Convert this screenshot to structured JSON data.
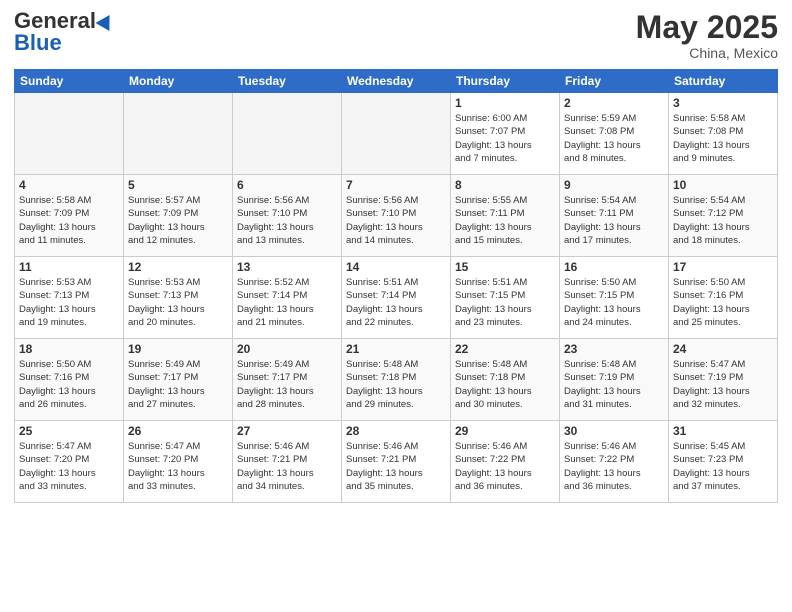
{
  "header": {
    "logo_general": "General",
    "logo_blue": "Blue",
    "title": "May 2025",
    "subtitle": "China, Mexico"
  },
  "days_of_week": [
    "Sunday",
    "Monday",
    "Tuesday",
    "Wednesday",
    "Thursday",
    "Friday",
    "Saturday"
  ],
  "weeks": [
    [
      {
        "day": "",
        "empty": true
      },
      {
        "day": "",
        "empty": true
      },
      {
        "day": "",
        "empty": true
      },
      {
        "day": "",
        "empty": true
      },
      {
        "day": "1",
        "lines": [
          "Sunrise: 6:00 AM",
          "Sunset: 7:07 PM",
          "Daylight: 13 hours",
          "and 7 minutes."
        ]
      },
      {
        "day": "2",
        "lines": [
          "Sunrise: 5:59 AM",
          "Sunset: 7:08 PM",
          "Daylight: 13 hours",
          "and 8 minutes."
        ]
      },
      {
        "day": "3",
        "lines": [
          "Sunrise: 5:58 AM",
          "Sunset: 7:08 PM",
          "Daylight: 13 hours",
          "and 9 minutes."
        ]
      }
    ],
    [
      {
        "day": "4",
        "lines": [
          "Sunrise: 5:58 AM",
          "Sunset: 7:09 PM",
          "Daylight: 13 hours",
          "and 11 minutes."
        ]
      },
      {
        "day": "5",
        "lines": [
          "Sunrise: 5:57 AM",
          "Sunset: 7:09 PM",
          "Daylight: 13 hours",
          "and 12 minutes."
        ]
      },
      {
        "day": "6",
        "lines": [
          "Sunrise: 5:56 AM",
          "Sunset: 7:10 PM",
          "Daylight: 13 hours",
          "and 13 minutes."
        ]
      },
      {
        "day": "7",
        "lines": [
          "Sunrise: 5:56 AM",
          "Sunset: 7:10 PM",
          "Daylight: 13 hours",
          "and 14 minutes."
        ]
      },
      {
        "day": "8",
        "lines": [
          "Sunrise: 5:55 AM",
          "Sunset: 7:11 PM",
          "Daylight: 13 hours",
          "and 15 minutes."
        ]
      },
      {
        "day": "9",
        "lines": [
          "Sunrise: 5:54 AM",
          "Sunset: 7:11 PM",
          "Daylight: 13 hours",
          "and 17 minutes."
        ]
      },
      {
        "day": "10",
        "lines": [
          "Sunrise: 5:54 AM",
          "Sunset: 7:12 PM",
          "Daylight: 13 hours",
          "and 18 minutes."
        ]
      }
    ],
    [
      {
        "day": "11",
        "lines": [
          "Sunrise: 5:53 AM",
          "Sunset: 7:13 PM",
          "Daylight: 13 hours",
          "and 19 minutes."
        ]
      },
      {
        "day": "12",
        "lines": [
          "Sunrise: 5:53 AM",
          "Sunset: 7:13 PM",
          "Daylight: 13 hours",
          "and 20 minutes."
        ]
      },
      {
        "day": "13",
        "lines": [
          "Sunrise: 5:52 AM",
          "Sunset: 7:14 PM",
          "Daylight: 13 hours",
          "and 21 minutes."
        ]
      },
      {
        "day": "14",
        "lines": [
          "Sunrise: 5:51 AM",
          "Sunset: 7:14 PM",
          "Daylight: 13 hours",
          "and 22 minutes."
        ]
      },
      {
        "day": "15",
        "lines": [
          "Sunrise: 5:51 AM",
          "Sunset: 7:15 PM",
          "Daylight: 13 hours",
          "and 23 minutes."
        ]
      },
      {
        "day": "16",
        "lines": [
          "Sunrise: 5:50 AM",
          "Sunset: 7:15 PM",
          "Daylight: 13 hours",
          "and 24 minutes."
        ]
      },
      {
        "day": "17",
        "lines": [
          "Sunrise: 5:50 AM",
          "Sunset: 7:16 PM",
          "Daylight: 13 hours",
          "and 25 minutes."
        ]
      }
    ],
    [
      {
        "day": "18",
        "lines": [
          "Sunrise: 5:50 AM",
          "Sunset: 7:16 PM",
          "Daylight: 13 hours",
          "and 26 minutes."
        ]
      },
      {
        "day": "19",
        "lines": [
          "Sunrise: 5:49 AM",
          "Sunset: 7:17 PM",
          "Daylight: 13 hours",
          "and 27 minutes."
        ]
      },
      {
        "day": "20",
        "lines": [
          "Sunrise: 5:49 AM",
          "Sunset: 7:17 PM",
          "Daylight: 13 hours",
          "and 28 minutes."
        ]
      },
      {
        "day": "21",
        "lines": [
          "Sunrise: 5:48 AM",
          "Sunset: 7:18 PM",
          "Daylight: 13 hours",
          "and 29 minutes."
        ]
      },
      {
        "day": "22",
        "lines": [
          "Sunrise: 5:48 AM",
          "Sunset: 7:18 PM",
          "Daylight: 13 hours",
          "and 30 minutes."
        ]
      },
      {
        "day": "23",
        "lines": [
          "Sunrise: 5:48 AM",
          "Sunset: 7:19 PM",
          "Daylight: 13 hours",
          "and 31 minutes."
        ]
      },
      {
        "day": "24",
        "lines": [
          "Sunrise: 5:47 AM",
          "Sunset: 7:19 PM",
          "Daylight: 13 hours",
          "and 32 minutes."
        ]
      }
    ],
    [
      {
        "day": "25",
        "lines": [
          "Sunrise: 5:47 AM",
          "Sunset: 7:20 PM",
          "Daylight: 13 hours",
          "and 33 minutes."
        ]
      },
      {
        "day": "26",
        "lines": [
          "Sunrise: 5:47 AM",
          "Sunset: 7:20 PM",
          "Daylight: 13 hours",
          "and 33 minutes."
        ]
      },
      {
        "day": "27",
        "lines": [
          "Sunrise: 5:46 AM",
          "Sunset: 7:21 PM",
          "Daylight: 13 hours",
          "and 34 minutes."
        ]
      },
      {
        "day": "28",
        "lines": [
          "Sunrise: 5:46 AM",
          "Sunset: 7:21 PM",
          "Daylight: 13 hours",
          "and 35 minutes."
        ]
      },
      {
        "day": "29",
        "lines": [
          "Sunrise: 5:46 AM",
          "Sunset: 7:22 PM",
          "Daylight: 13 hours",
          "and 36 minutes."
        ]
      },
      {
        "day": "30",
        "lines": [
          "Sunrise: 5:46 AM",
          "Sunset: 7:22 PM",
          "Daylight: 13 hours",
          "and 36 minutes."
        ]
      },
      {
        "day": "31",
        "lines": [
          "Sunrise: 5:45 AM",
          "Sunset: 7:23 PM",
          "Daylight: 13 hours",
          "and 37 minutes."
        ]
      }
    ]
  ]
}
